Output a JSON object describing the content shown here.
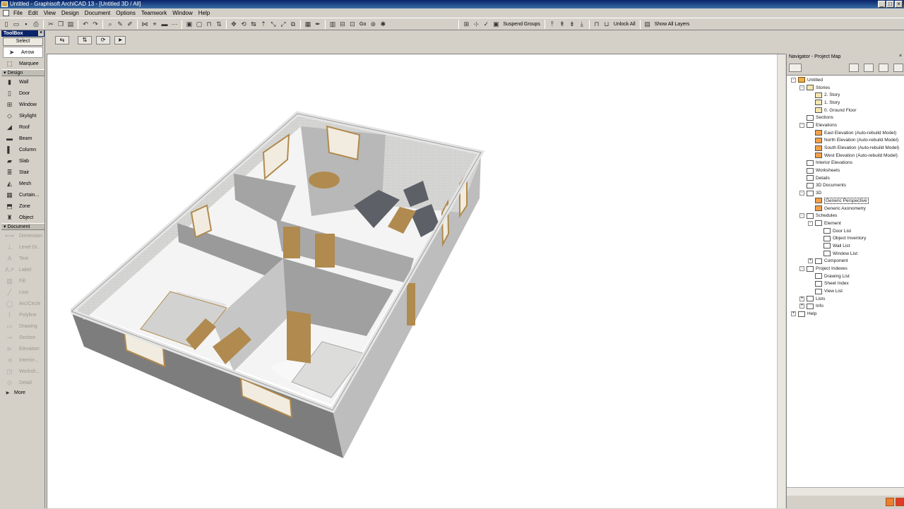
{
  "window": {
    "title": "Untitled - Graphisoft ArchiCAD 13 - [Untitled 3D / All]"
  },
  "menu": [
    "File",
    "Edit",
    "View",
    "Design",
    "Document",
    "Options",
    "Teamwork",
    "Window",
    "Help"
  ],
  "toolbar": {
    "suspend_groups": "Suspend Groups",
    "go": "Go",
    "unlock_all": "Unlock All",
    "show_all_layers": "Show All Layers"
  },
  "toolbox": {
    "title": "ToolBox",
    "select_label": "Select",
    "select_tools": [
      "Arrow",
      "Marquee"
    ],
    "design_label": "Design",
    "design_tools": [
      "Wall",
      "Door",
      "Window",
      "Skylight",
      "Roof",
      "Beam",
      "Column",
      "Slab",
      "Stair",
      "Mesh",
      "Curtain...",
      "Zone",
      "Object"
    ],
    "document_label": "Document",
    "document_tools": [
      "Dimension",
      "Level Di...",
      "Text",
      "Label",
      "Fill",
      "Line",
      "Arc/Circle",
      "Polyline",
      "Drawing",
      "Section",
      "Elevation",
      "Interior...",
      "Worksh...",
      "Detail"
    ],
    "more_label": "More"
  },
  "navigator": {
    "title": "Navigator - Project Map",
    "tree": [
      {
        "label": "Untitled",
        "level": 0,
        "tog": "-",
        "icon": "house"
      },
      {
        "label": "Stories",
        "level": 1,
        "tog": "-",
        "icon": "fold"
      },
      {
        "label": "2. Story",
        "level": 2,
        "tog": "",
        "icon": "fold"
      },
      {
        "label": "1. Story",
        "level": 2,
        "tog": "",
        "icon": "fold"
      },
      {
        "label": "0. Ground Floor",
        "level": 2,
        "tog": "",
        "icon": "fold"
      },
      {
        "label": "Sections",
        "level": 1,
        "tog": "",
        "icon": "list"
      },
      {
        "label": "Elevations",
        "level": 1,
        "tog": "-",
        "icon": "list"
      },
      {
        "label": "East Elevation (Auto-rebuild Model)",
        "level": 2,
        "tog": "",
        "icon": "elev"
      },
      {
        "label": "North Elevation (Auto-rebuild Model)",
        "level": 2,
        "tog": "",
        "icon": "elev"
      },
      {
        "label": "South Elevation (Auto-rebuild Model)",
        "level": 2,
        "tog": "",
        "icon": "elev"
      },
      {
        "label": "West Elevation (Auto-rebuild Model)",
        "level": 2,
        "tog": "",
        "icon": "elev"
      },
      {
        "label": "Interior Elevations",
        "level": 1,
        "tog": "",
        "icon": "list"
      },
      {
        "label": "Worksheets",
        "level": 1,
        "tog": "",
        "icon": "list"
      },
      {
        "label": "Details",
        "level": 1,
        "tog": "",
        "icon": "list"
      },
      {
        "label": "3D Documents",
        "level": 1,
        "tog": "",
        "icon": "list"
      },
      {
        "label": "3D",
        "level": 1,
        "tog": "-",
        "icon": "list"
      },
      {
        "label": "Generic Perspective",
        "level": 2,
        "tog": "",
        "icon": "elev",
        "selected": true
      },
      {
        "label": "Generic Axonometry",
        "level": 2,
        "tog": "",
        "icon": "elev"
      },
      {
        "label": "Schedules",
        "level": 1,
        "tog": "-",
        "icon": "list"
      },
      {
        "label": "Element",
        "level": 2,
        "tog": "-",
        "icon": "list"
      },
      {
        "label": "Door List",
        "level": 3,
        "tog": "",
        "icon": "list"
      },
      {
        "label": "Object Inventory",
        "level": 3,
        "tog": "",
        "icon": "list"
      },
      {
        "label": "Wall List",
        "level": 3,
        "tog": "",
        "icon": "list"
      },
      {
        "label": "Window List",
        "level": 3,
        "tog": "",
        "icon": "list"
      },
      {
        "label": "Component",
        "level": 2,
        "tog": "+",
        "icon": "list"
      },
      {
        "label": "Project Indexes",
        "level": 1,
        "tog": "-",
        "icon": "list"
      },
      {
        "label": "Drawing List",
        "level": 2,
        "tog": "",
        "icon": "list"
      },
      {
        "label": "Sheet Index",
        "level": 2,
        "tog": "",
        "icon": "list"
      },
      {
        "label": "View List",
        "level": 2,
        "tog": "",
        "icon": "list"
      },
      {
        "label": "Lists",
        "level": 1,
        "tog": "+",
        "icon": "list"
      },
      {
        "label": "Info",
        "level": 1,
        "tog": "+",
        "icon": "list"
      },
      {
        "label": "Help",
        "level": 0,
        "tog": "+",
        "icon": "list"
      }
    ]
  }
}
